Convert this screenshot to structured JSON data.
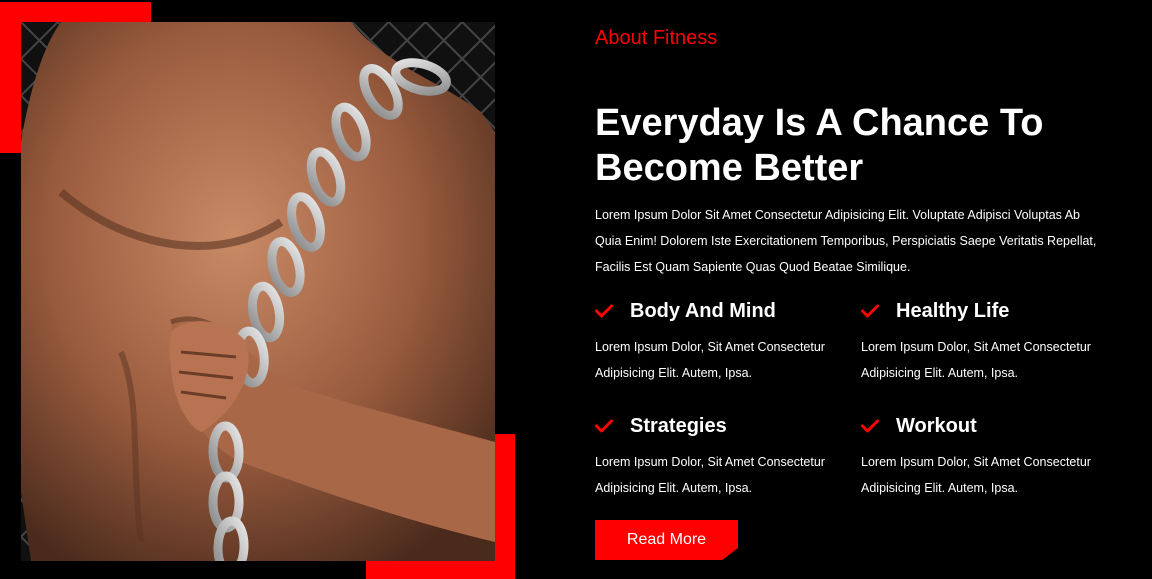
{
  "about": {
    "subtitle": "About Fitness",
    "heading": "Everyday Is A Chance To Become Better",
    "intro": "Lorem Ipsum Dolor Sit Amet Consectetur Adipisicing Elit. Voluptate Adipisci Voluptas Ab Quia Enim! Dolorem Iste Exercitationem Temporibus, Perspiciatis Saepe Veritatis Repellat, Facilis Est Quam Sapiente Quas Quod Beatae Similique.",
    "features": [
      {
        "title": "Body And Mind",
        "text": "Lorem Ipsum Dolor, Sit Amet Consectetur Adipisicing Elit. Autem, Ipsa.",
        "icon": "check-icon"
      },
      {
        "title": "Healthy Life",
        "text": "Lorem Ipsum Dolor, Sit Amet Consectetur Adipisicing Elit. Autem, Ipsa.",
        "icon": "check-icon"
      },
      {
        "title": "Strategies",
        "text": "Lorem Ipsum Dolor, Sit Amet Consectetur Adipisicing Elit. Autem, Ipsa.",
        "icon": "check-icon"
      },
      {
        "title": "Workout",
        "text": "Lorem Ipsum Dolor, Sit Amet Consectetur Adipisicing Elit. Autem, Ipsa.",
        "icon": "check-icon"
      }
    ],
    "button_label": "Read More"
  },
  "theme": {
    "accent": "#ff0000",
    "background": "#000000",
    "text": "#ffffff"
  }
}
